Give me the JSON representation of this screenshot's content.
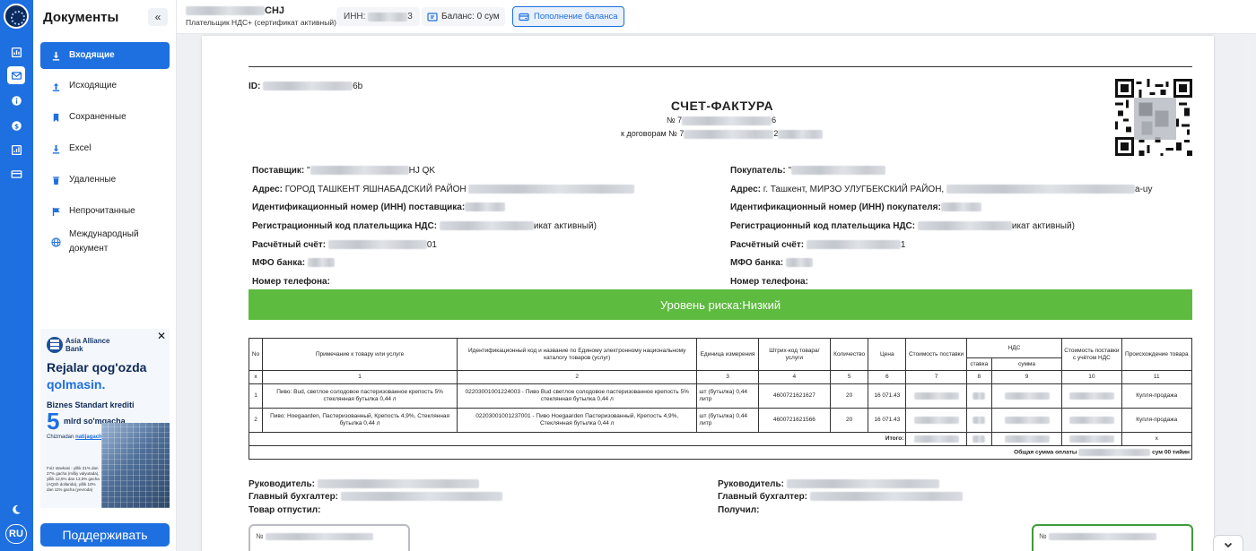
{
  "sidebar": {
    "title": "Документы",
    "collapse_glyph": "«",
    "items": [
      {
        "label": "Входящие",
        "icon": "download-icon",
        "active": true
      },
      {
        "label": "Исходящие",
        "icon": "upload-icon"
      },
      {
        "label": "Сохраненные",
        "icon": "bookmark-icon"
      },
      {
        "label": "Excel",
        "icon": "excel-download-icon"
      },
      {
        "label": "Удаленные",
        "icon": "trash-icon"
      },
      {
        "label": "Непрочитанные",
        "icon": "flag-icon"
      },
      {
        "label": "Международный документ",
        "icon": "globe-icon"
      }
    ],
    "support_label": "Поддерживать"
  },
  "rail": {
    "lang": "RU",
    "icons": [
      "app-logo-icon",
      "dashboard-icon",
      "mail-icon",
      "info-icon",
      "currency-icon",
      "report-icon",
      "card-icon",
      "moon-icon"
    ]
  },
  "ad": {
    "bank_name": "Asia Alliance Bank",
    "line1": "Rejalar qog'ozda",
    "line2": "qolmasin.",
    "line3": "Biznes Standart krediti",
    "big_number": "5",
    "big_text": "mlrd so'mgacha",
    "sub_prefix": "Chizmadan",
    "sub_link": "natijagacha",
    "fine_print": "Foiz stavkasi - yillik 21% dan 27% gacha (milliy valyutada), yillik 12,5% dan 13,5% gacha (AQSh dollarida), yillik 10% dan 11% gacha (yevroda)"
  },
  "header": {
    "company_suffix": "CHJ",
    "company_status": "Плательщик НДС+ (сертификат активный)",
    "inn_label": "ИНН:",
    "inn_suffix": "3",
    "balance_label": "Баланс: 0 сум",
    "topup_label": "Пополнение баланса"
  },
  "doc": {
    "id_label": "ID:",
    "id_suffix": "6b",
    "title": "СЧЕТ-ФАКТУРА",
    "number_prefix": "№ 7",
    "number_suffix": "6",
    "contract_prefix": "к договорам № 7",
    "contract_suffix": "2",
    "supplier": {
      "name_label": "Поставщик:",
      "name_prefix": "\"",
      "name_suffix": "HJ QK",
      "address_label": "Адрес:",
      "address_value": "ГОРОД ТАШКЕНТ ЯШНАБАДСКИЙ РАЙОН",
      "inn_label": "Идентификационный номер (ИНН) поставщика:",
      "vat_label": "Регистрационный код плательщика НДС:",
      "vat_suffix": "икат активный)",
      "account_label": "Расчётный счёт:",
      "account_suffix": "01",
      "mfo_label": "МФО банка:",
      "phone_label": "Номер телефона:"
    },
    "buyer": {
      "name_label": "Покупатель:",
      "name_prefix": "\"",
      "address_label": "Адрес:",
      "address_value": "г. Ташкент, МИРЗО УЛУГБЕКСКИЙ РАЙОН,",
      "address_suffix": "a-uy",
      "inn_label": "Идентификационный номер (ИНН) покупателя:",
      "vat_label": "Регистрационный код плательщика НДС:",
      "vat_suffix": "икат активный)",
      "account_label": "Расчётный счёт:",
      "account_suffix": "1",
      "mfo_label": "МФО банка:",
      "phone_label": "Номер телефона:"
    },
    "risk_label": "Уровень риска:Низкий",
    "table": {
      "headers": {
        "no": "No",
        "note": "Примечание к товару или услуге",
        "code": "Идентификационный код и название по Единому электронному национальному каталогу товаров (услуг)",
        "unit": "Единица измерения",
        "barcode": "Штрих-код товара/услуги",
        "qty": "Количество",
        "price": "Цена",
        "cost": "Стоимость поставки",
        "vat": "НДС",
        "vat_rate": "ставка",
        "vat_sum": "сумма",
        "total": "Стоимость поставки с учётом НДС",
        "origin": "Происхождение товара"
      },
      "index_row": [
        "x",
        "1",
        "2",
        "3",
        "4",
        "5",
        "6",
        "7",
        "8",
        "9",
        "10",
        "11"
      ],
      "rows": [
        {
          "no": "1",
          "note": "Пиво: Bud, светлое солодовое пастеризованное крепость 5% стеклянная бутылка 0,44 л",
          "code": "02203001001224003 - Пиво Bud светлое солодовое пастеризованное крепость 5% стеклянная бутылка 0,44 л",
          "unit": "шт (бутылка) 0,44 литр",
          "barcode": "4600721621627",
          "qty": "20",
          "price": "16 071.43",
          "origin": "Купля-продажа"
        },
        {
          "no": "2",
          "note": "Пиво: Hoegaarden, Пастеризованный, Крепость 4,9%, Стеклянная бутылка 0,44 л",
          "code": "02203001001237001 - Пиво Hoegaarden Пастеризованный, Крепость 4,9%, Стеклянная бутылка 0,44 л",
          "unit": "шт (бутылка) 0,44 литр",
          "barcode": "4600721621566",
          "qty": "20",
          "price": "16 071.43",
          "origin": "Купля-продажа"
        }
      ],
      "total_label": "Итого:",
      "total_origin": "x",
      "grand_label": "Общая сумма оплаты",
      "grand_suffix": "сум 00 тийин"
    },
    "signatures": {
      "left_head": "Руководитель:",
      "left_accountant": "Главный бухгалтер:",
      "left_released": "Товар отпустил:",
      "right_head": "Руководитель:",
      "right_accountant": "Главный бухгалтер:",
      "right_received": "Получил:"
    },
    "seal_left": "№",
    "seal_right": "№"
  }
}
